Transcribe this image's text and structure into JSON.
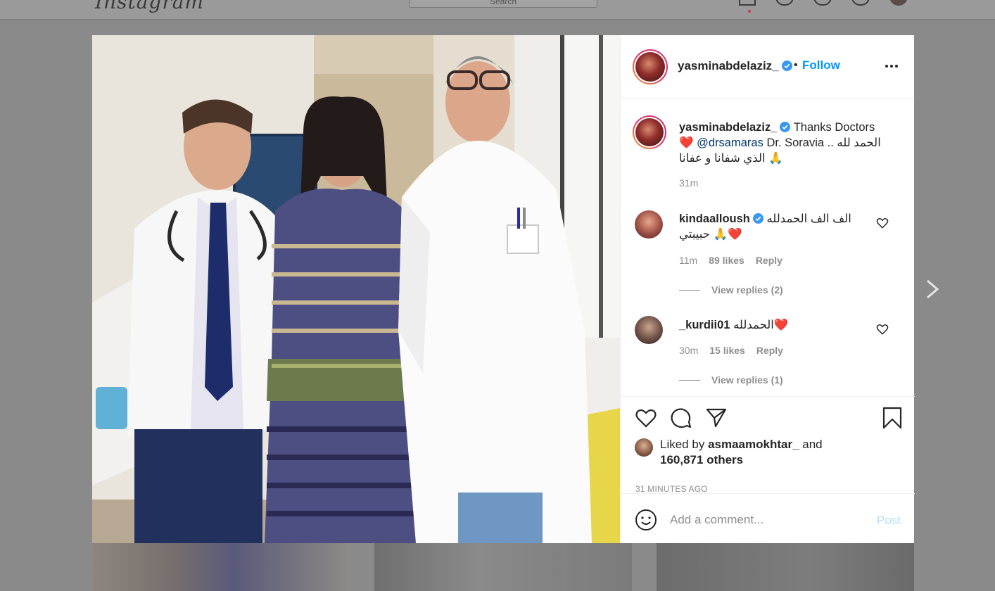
{
  "background": {
    "logo_text": "Instagram",
    "search_placeholder": "Search",
    "nav_icons": [
      "home-icon",
      "messenger-icon",
      "explore-icon",
      "activity-heart-icon",
      "profile-avatar"
    ]
  },
  "post": {
    "photo_alt": "",
    "header": {
      "username": "yasminabdelaziz_",
      "verified": true,
      "separator": "•",
      "follow_label": "Follow",
      "more_icon": "more-options-icon"
    },
    "caption": {
      "username": "yasminabdelaziz_",
      "text_1": "Thanks Doctors",
      "heart": "❤️",
      "mention": "@drsamaras",
      "text_2": "Dr. Soravia .. الحمد لله",
      "text_3": "الذي شفانا و عفانا 🙏",
      "time": "31m"
    },
    "comments": [
      {
        "username": "kindaalloush",
        "verified": true,
        "text_1": "الف الف الحمدلله",
        "text_2": "حبيبتي 🙏❤️",
        "time": "11m",
        "likes": "89 likes",
        "reply_label": "Reply",
        "view_replies": "View replies (2)"
      },
      {
        "username": "_kurdii01",
        "verified": false,
        "text_1": "الحمدلله❤️",
        "time": "30m",
        "likes": "15 likes",
        "reply_label": "Reply",
        "view_replies": "View replies (1)"
      }
    ],
    "actions": {
      "icons": [
        "like-heart-icon",
        "comment-icon",
        "share-icon",
        "save-bookmark-icon"
      ],
      "liked_by_prefix": "Liked by",
      "liked_by_user": "asmaamokhtar_",
      "liked_by_and": "and",
      "liked_by_others": "160,871 others",
      "timestamp": "31 MINUTES AGO"
    },
    "add_comment": {
      "placeholder": "Add a comment...",
      "post_label": "Post",
      "emoji_icon": "emoji-smiley-icon"
    }
  },
  "colors": {
    "follow_blue": "#0095f6",
    "verified_blue": "#3897f0",
    "post_disabled": "#b2dffc",
    "muted_text": "#8e8e8e",
    "overlay": "#8a8a8a"
  }
}
